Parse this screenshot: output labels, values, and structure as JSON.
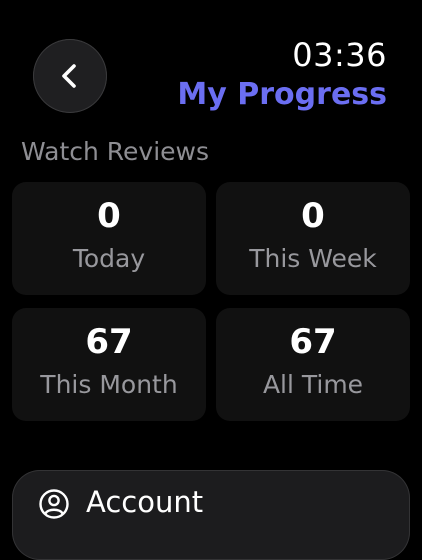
{
  "header": {
    "back_icon": "chevron-left-icon",
    "time": "03:36",
    "title": "My Progress",
    "title_color": "#6b6ef2"
  },
  "section": {
    "label": "Watch Reviews"
  },
  "stats": [
    {
      "value": "0",
      "label": "Today"
    },
    {
      "value": "0",
      "label": "This Week"
    },
    {
      "value": "67",
      "label": "This Month"
    },
    {
      "value": "67",
      "label": "All Time"
    }
  ],
  "account": {
    "icon": "person-circle-icon",
    "label": "Account"
  }
}
